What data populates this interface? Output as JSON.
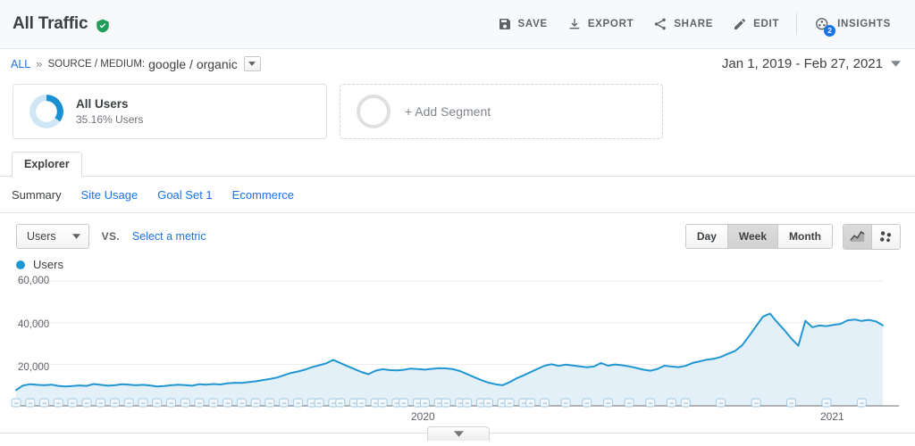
{
  "header": {
    "title": "All Traffic",
    "verified_icon": "shield-check-icon",
    "actions": [
      {
        "label": "SAVE",
        "icon": "save-icon"
      },
      {
        "label": "EXPORT",
        "icon": "export-icon"
      },
      {
        "label": "SHARE",
        "icon": "share-icon"
      },
      {
        "label": "EDIT",
        "icon": "edit-icon"
      },
      {
        "label": "INSIGHTS",
        "icon": "insights-icon",
        "badge": "2"
      }
    ]
  },
  "breadcrumb": {
    "all": "ALL",
    "separator": "»",
    "dimension_key": "SOURCE / MEDIUM:",
    "dimension_value": "google / organic"
  },
  "date_range": {
    "value": "Jan 1, 2019 - Feb 27, 2021",
    "icon": "chevron-down-icon"
  },
  "segments": [
    {
      "name": "All Users",
      "sub": "35.16% Users",
      "percent": 35.16
    },
    {
      "name": "+ Add Segment"
    }
  ],
  "tabs": {
    "explorer": "Explorer"
  },
  "subtabs": [
    {
      "label": "Summary",
      "active": true
    },
    {
      "label": "Site Usage",
      "active": false
    },
    {
      "label": "Goal Set 1",
      "active": false
    },
    {
      "label": "Ecommerce",
      "active": false
    }
  ],
  "controls": {
    "metric_selected": "Users",
    "vs_label": "VS.",
    "select_metric": "Select a metric",
    "granularity": [
      {
        "label": "Day",
        "active": false
      },
      {
        "label": "Week",
        "active": true
      },
      {
        "label": "Month",
        "active": false
      }
    ],
    "view_buttons": [
      {
        "icon": "line-chart-icon",
        "active": true
      },
      {
        "icon": "scatter-plot-icon",
        "active": false
      }
    ]
  },
  "legend": {
    "series": "Users",
    "color": "#2196d3"
  },
  "chart_data": {
    "type": "area",
    "title": "Users",
    "xlabel": "",
    "ylabel": "Users",
    "ylim": [
      0,
      60000
    ],
    "yticks": [
      20000,
      40000,
      60000
    ],
    "ytick_labels": [
      "20,000",
      "40,000",
      "60,000"
    ],
    "grid": true,
    "legend_position": "top-left",
    "x_year_labels": [
      {
        "label": "2020",
        "x_index": 52
      },
      {
        "label": "2021",
        "x_index": 104
      }
    ],
    "annotation_markers": true,
    "series": [
      {
        "name": "Users",
        "color": "#2196d3",
        "fill": "#e3f0f8",
        "values": [
          7600,
          9800,
          10400,
          10100,
          9900,
          10200,
          9600,
          9300,
          9500,
          9800,
          9600,
          10500,
          10100,
          9700,
          9900,
          10400,
          10200,
          9900,
          10100,
          9800,
          9300,
          9500,
          9900,
          10200,
          10000,
          9700,
          10400,
          10200,
          10500,
          10300,
          10800,
          11100,
          11000,
          11400,
          11800,
          12400,
          12900,
          13600,
          14700,
          15800,
          16500,
          17400,
          18600,
          19500,
          20400,
          22100,
          20600,
          19100,
          17700,
          16300,
          15200,
          16900,
          17600,
          17200,
          17000,
          17300,
          17900,
          17700,
          17400,
          17800,
          18100,
          18000,
          17600,
          16700,
          15300,
          13800,
          12400,
          11200,
          10400,
          9900,
          11300,
          13200,
          14600,
          16200,
          17800,
          19300,
          20000,
          19200,
          19800,
          19400,
          19000,
          18500,
          18900,
          20600,
          19300,
          19900,
          19500,
          19000,
          18200,
          17400,
          16900,
          17700,
          19300,
          18900,
          18600,
          19200,
          20600,
          21400,
          22200,
          22600,
          23500,
          25000,
          26300,
          29000,
          33500,
          38200,
          42900,
          44300,
          40200,
          36500,
          32400,
          28900,
          40900,
          37800,
          38600,
          38300,
          38900,
          39400,
          41100,
          41500,
          40800,
          41300,
          40600,
          38700
        ]
      }
    ]
  },
  "footer": {
    "collapse_icon": "chevron-down-icon"
  }
}
